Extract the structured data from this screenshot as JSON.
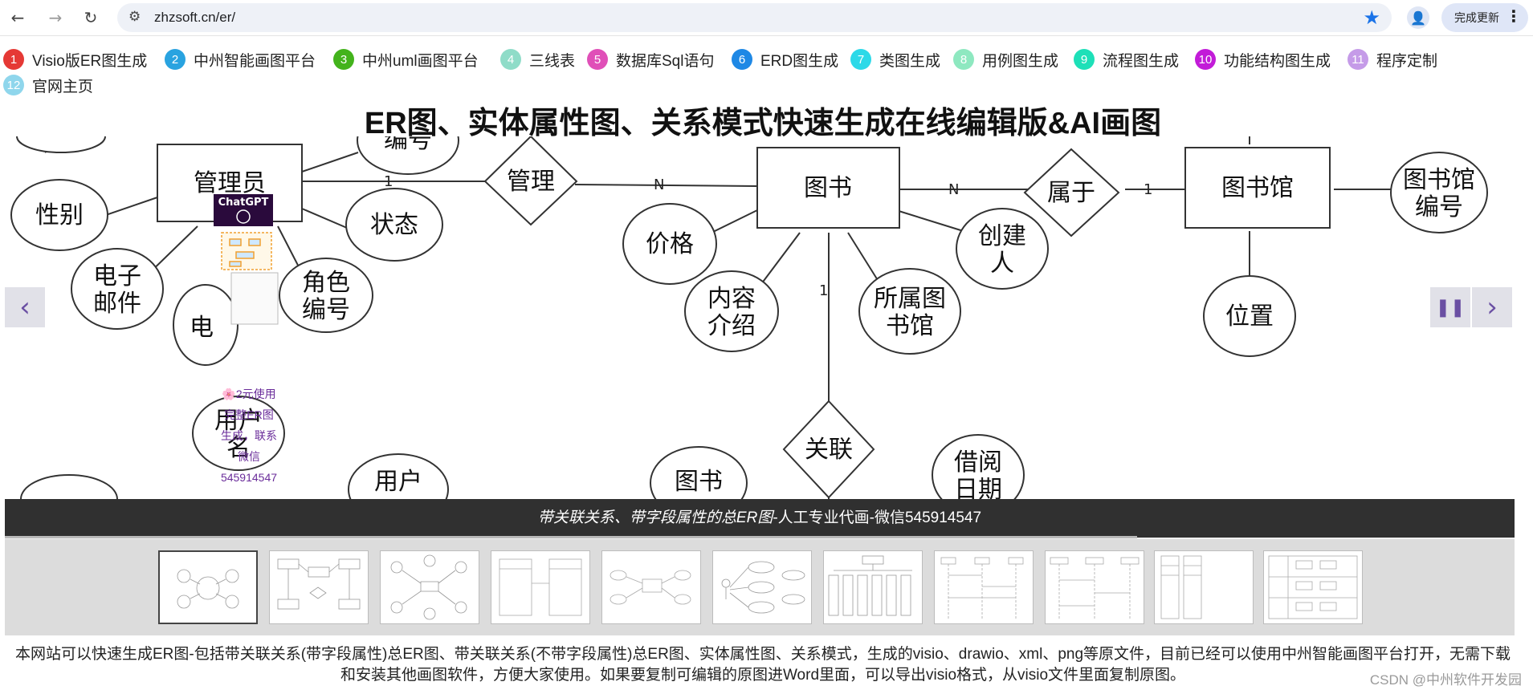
{
  "browser": {
    "url": "zhzsoft.cn/er/",
    "update_label": "完成更新"
  },
  "nav": {
    "items": [
      {
        "num": "1",
        "label": "Visio版ER图生成",
        "color": "#e53935"
      },
      {
        "num": "2",
        "label": "中州智能画图平台",
        "color": "#29a3e0"
      },
      {
        "num": "3",
        "label": "中州uml画图平台",
        "color": "#43b31c"
      },
      {
        "num": "4",
        "label": "三线表",
        "color": "#8fdcc8"
      },
      {
        "num": "5",
        "label": "数据库Sql语句",
        "color": "#e04fb8"
      },
      {
        "num": "6",
        "label": "ERD图生成",
        "color": "#1e88e5"
      },
      {
        "num": "7",
        "label": "类图生成",
        "color": "#2cd9e8"
      },
      {
        "num": "8",
        "label": "用例图生成",
        "color": "#8ee8c0"
      },
      {
        "num": "9",
        "label": "流程图生成",
        "color": "#1de0b8"
      },
      {
        "num": "10",
        "label": "功能结构图生成",
        "color": "#c21bd8"
      },
      {
        "num": "11",
        "label": "程序定制",
        "color": "#c59be8"
      },
      {
        "num": "12",
        "label": "官网主页",
        "color": "#8fd6ec"
      }
    ]
  },
  "page_title": "ER图、实体属性图、关系模式快速生成在线编辑版&AI画图",
  "slide": {
    "caption_italic": "带关联关系、带字段属性的总ER图",
    "caption_rest": "-人工专业代画-微信545914547",
    "entities": [
      "管理员",
      "图书",
      "图书馆"
    ],
    "relations": [
      "管理",
      "属于",
      "关联"
    ],
    "attributes": [
      "编号",
      "性别",
      "状态",
      "电子邮件",
      "角色编号",
      "电",
      "用户名",
      "用户",
      "价格",
      "内容介绍",
      "所属图书馆",
      "创建人",
      "图书馆编号",
      "位置",
      "图书",
      "借阅日期"
    ],
    "cardinalities": [
      "1",
      "N",
      "N",
      "1",
      "1"
    ],
    "chatgpt_label": "ChatGPT"
  },
  "promo": {
    "lines": [
      "🌸2元使用",
      "完整ER图",
      "生成，联系",
      "微信",
      "545914547"
    ]
  },
  "description": "本网站可以快速生成ER图-包括带关联关系(带字段属性)总ER图、带关联关系(不带字段属性)总ER图、实体属性图、关系模式，生成的visio、drawio、xml、png等原文件，目前已经可以使用中州智能画图平台打开，无需下载和安装其他画图软件，方便大家使用。如果要复制可编辑的原图进Word里面，可以导出visio格式，从visio文件里面复制原图。",
  "watermark": "CSDN @中州软件开发园"
}
